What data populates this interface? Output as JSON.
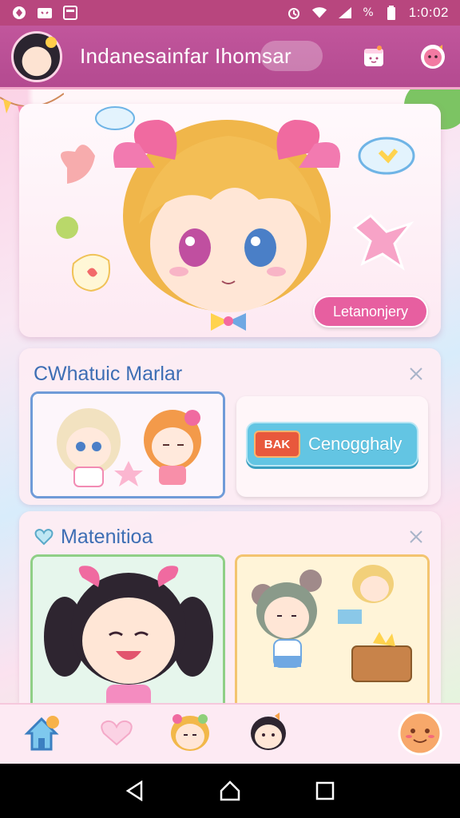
{
  "status_bar": {
    "time": "1:0:02",
    "battery_text": "%",
    "icons": [
      "app-notification-icon",
      "cat-icon",
      "tablet-icon",
      "alarm-icon",
      "wifi-icon",
      "signal-icon",
      "battery-icon"
    ]
  },
  "app_bar": {
    "title": "Indanesainfar Ihomsar",
    "actions": [
      "calendar-icon",
      "character-icon"
    ]
  },
  "hero": {
    "button_label": "Letanonjery"
  },
  "section_1": {
    "title": "CWhatuic Marlar",
    "cta": {
      "badge": "BAK",
      "label": "Cenogghaly"
    }
  },
  "section_2": {
    "title": "Matenitioa"
  },
  "bottom_nav": {
    "items": [
      "home-icon",
      "heart-icon",
      "character-blonde-icon",
      "character-dark-icon",
      "mascot-icon"
    ]
  },
  "system_nav": {
    "items": [
      "back-icon",
      "home-circle-icon",
      "recents-icon"
    ]
  },
  "colors": {
    "status_bar": "#b8467e",
    "app_bar": "#c1569c",
    "accent_pink": "#e75fa0",
    "accent_blue": "#63c5e3",
    "title_blue": "#3d6eb4"
  }
}
